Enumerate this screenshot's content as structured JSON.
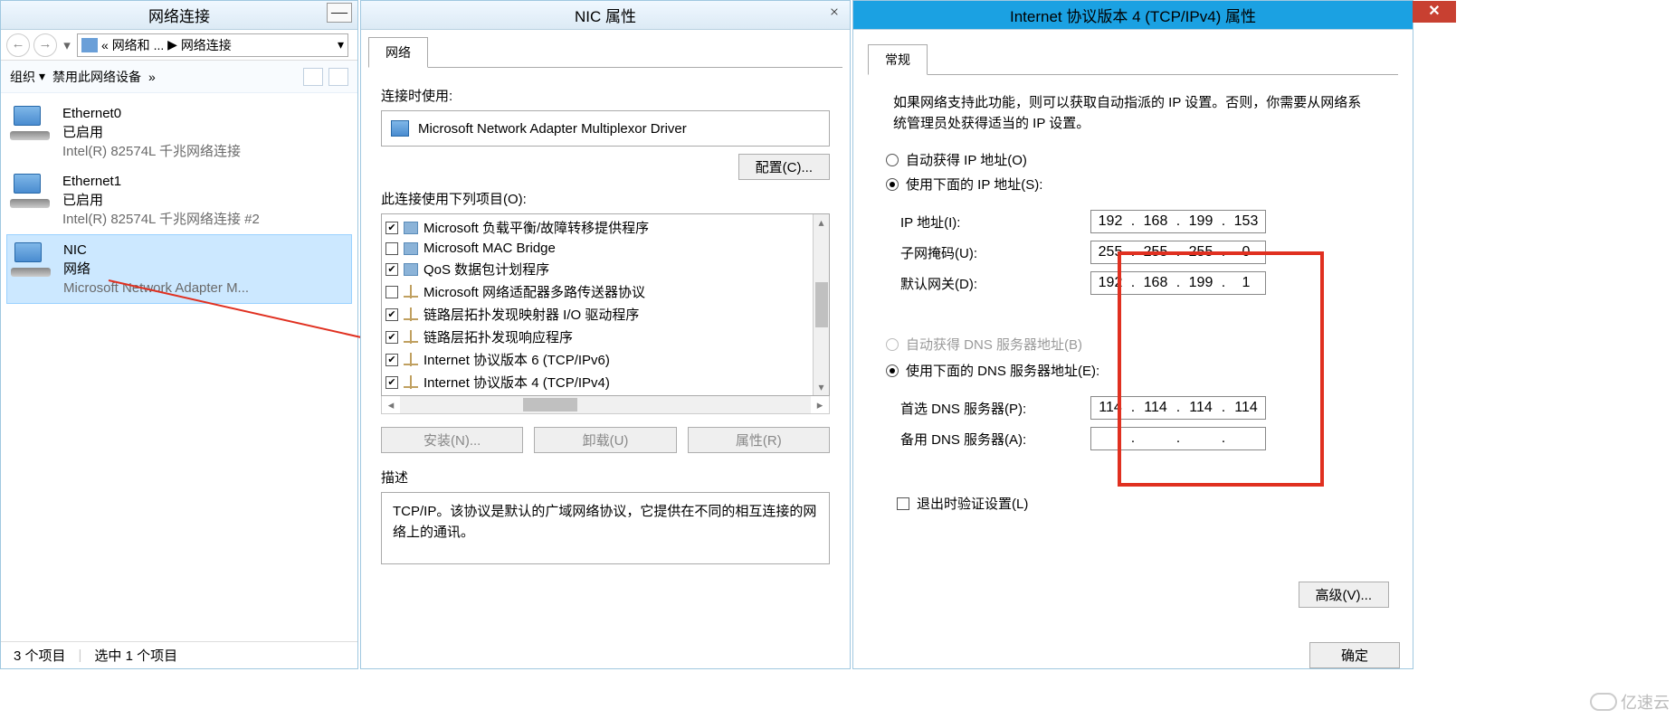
{
  "win1": {
    "title": "网络连接",
    "minimize": "—",
    "nav": {
      "back": "←",
      "forward": "→",
      "drop": "▾"
    },
    "address": {
      "prefix": "«",
      "mid": "网络和 ...",
      "sep": "▶",
      "tail": "网络连接",
      "drop": "▾"
    },
    "toolbar": {
      "org": "组织",
      "org_drop": "▾",
      "disable": "禁用此网络设备",
      "more": "»"
    },
    "items": [
      {
        "name": "Ethernet0",
        "status": "已启用",
        "device": "Intel(R) 82574L 千兆网络连接"
      },
      {
        "name": "Ethernet1",
        "status": "已启用",
        "device": "Intel(R) 82574L 千兆网络连接 #2"
      },
      {
        "name": "NIC",
        "status": "网络",
        "device": "Microsoft Network Adapter M..."
      }
    ],
    "status": {
      "count": "3 个项目",
      "selected": "选中 1 个项目"
    }
  },
  "win2": {
    "title": "NIC 属性",
    "close": "×",
    "tab": "网络",
    "connect_using": "连接时使用:",
    "adapter": "Microsoft Network Adapter Multiplexor Driver",
    "config_btn": "配置(C)...",
    "items_label": "此连接使用下列项目(O):",
    "proto_items": [
      {
        "checked": true,
        "icon": "svc",
        "label": "Microsoft 负载平衡/故障转移提供程序"
      },
      {
        "checked": false,
        "icon": "svc",
        "label": "Microsoft MAC Bridge"
      },
      {
        "checked": true,
        "icon": "svc",
        "label": "QoS 数据包计划程序"
      },
      {
        "checked": false,
        "icon": "net",
        "label": "Microsoft 网络适配器多路传送器协议"
      },
      {
        "checked": true,
        "icon": "net",
        "label": "链路层拓扑发现映射器 I/O 驱动程序"
      },
      {
        "checked": true,
        "icon": "net",
        "label": "链路层拓扑发现响应程序"
      },
      {
        "checked": true,
        "icon": "net",
        "label": "Internet 协议版本 6 (TCP/IPv6)"
      },
      {
        "checked": true,
        "icon": "net",
        "label": "Internet 协议版本 4 (TCP/IPv4)"
      }
    ],
    "install_btn": "安装(N)...",
    "uninstall_btn": "卸载(U)",
    "props_btn": "属性(R)",
    "desc_label": "描述",
    "desc_text": "TCP/IP。该协议是默认的广域网络协议，它提供在不同的相互连接的网络上的通讯。"
  },
  "win3": {
    "title": "Internet 协议版本 4 (TCP/IPv4) 属性",
    "close": "✕",
    "tab": "常规",
    "intro": "如果网络支持此功能，则可以获取自动指派的 IP 设置。否则，你需要从网络系统管理员处获得适当的 IP 设置。",
    "radio_auto_ip": "自动获得 IP 地址(O)",
    "radio_use_ip": "使用下面的 IP 地址(S):",
    "ip_label": "IP 地址(I):",
    "ip_val": [
      "192",
      "168",
      "199",
      "153"
    ],
    "mask_label": "子网掩码(U):",
    "mask_val": [
      "255",
      "255",
      "255",
      "0"
    ],
    "gw_label": "默认网关(D):",
    "gw_val": [
      "192",
      "168",
      "199",
      "1"
    ],
    "radio_auto_dns": "自动获得 DNS 服务器地址(B)",
    "radio_use_dns": "使用下面的 DNS 服务器地址(E):",
    "dns1_label": "首选 DNS 服务器(P):",
    "dns1_val": [
      "114",
      "114",
      "114",
      "114"
    ],
    "dns2_label": "备用 DNS 服务器(A):",
    "dns2_val": [
      "",
      "",
      "",
      ""
    ],
    "exit_check": "退出时验证设置(L)",
    "adv_btn": "高级(V)...",
    "ok_btn": "确定"
  },
  "watermark": "亿速云"
}
